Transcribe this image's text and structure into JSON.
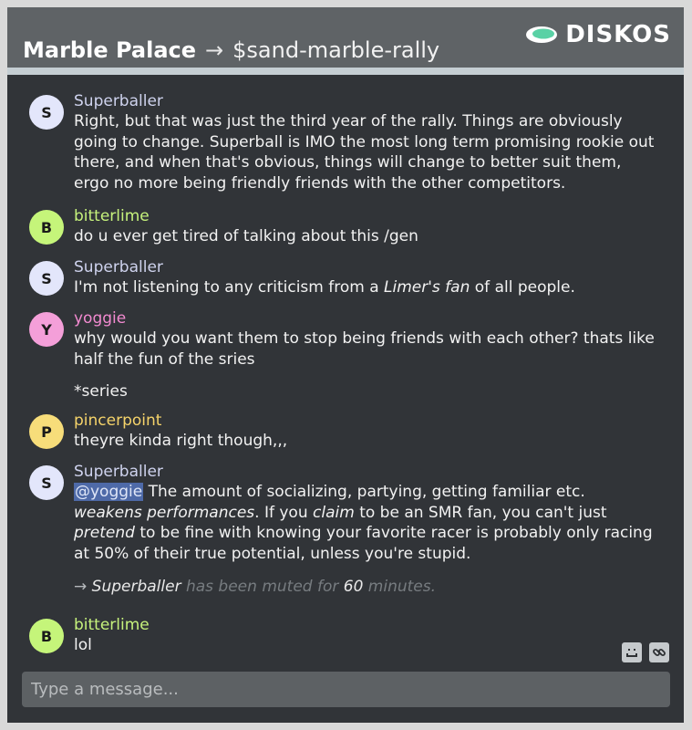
{
  "header": {
    "server": "Marble Palace",
    "arrow": "→",
    "channel": "$sand-marble-rally",
    "logo_text": "DISKOS",
    "logo_color": "#5ad1a5"
  },
  "messages": [
    {
      "initial": "S",
      "author": "Superballer",
      "author_color": "#cfd3ee",
      "avatar_color": "#e3e6fb",
      "text": "Right, but that was just the third year of the rally. Things are obviously going to change. Superball is IMO the most long term promising rookie out there, and when that's obvious, things will change to better suit them, ergo no more being friendly friends with the other competitors."
    },
    {
      "initial": "B",
      "author": "bitterlime",
      "author_color": "#c6f27c",
      "avatar_color": "#c5f57a",
      "text": "do u ever get tired of talking about this /gen"
    },
    {
      "initial": "S",
      "author": "Superballer",
      "author_color": "#cfd3ee",
      "avatar_color": "#e3e6fb",
      "text_a": "I'm not listening to any criticism from a ",
      "text_em": "Limer's fan",
      "text_b": " of all people."
    },
    {
      "initial": "Y",
      "author": "yoggie",
      "author_color": "#f28ad0",
      "avatar_color": "#f49fd9",
      "text": "why would you want them to stop being friends with each other? thats like half the fun of the sries",
      "followup": "*series"
    },
    {
      "initial": "P",
      "author": "pincerpoint",
      "author_color": "#f5d36a",
      "avatar_color": "#f7dd7a",
      "text": "theyre kinda right though,,,"
    },
    {
      "initial": "S",
      "author": "Superballer",
      "author_color": "#cfd3ee",
      "avatar_color": "#e3e6fb",
      "mention": "@yoggie",
      "p1": " The amount of socializing, partying, getting familiar etc. ",
      "em1": "weakens performances",
      "p2": ". If you ",
      "em2": "claim",
      "p3": " to be an SMR fan, you can't just ",
      "em3": "pretend",
      "p4": " to be fine with knowing your favorite racer is probably only racing at 50% of their true potential, unless you're stupid."
    },
    {
      "initial": "B",
      "author": "bitterlime",
      "author_color": "#c6f27c",
      "avatar_color": "#c5f57a",
      "text": "lol"
    }
  ],
  "system": {
    "arrow": "→",
    "user": "Superballer",
    "mid": " has been muted for ",
    "amount": "60",
    "end": " minutes."
  },
  "tools": [
    "emoji-icon",
    "link-icon"
  ],
  "composer": {
    "placeholder": "Type a message..."
  }
}
